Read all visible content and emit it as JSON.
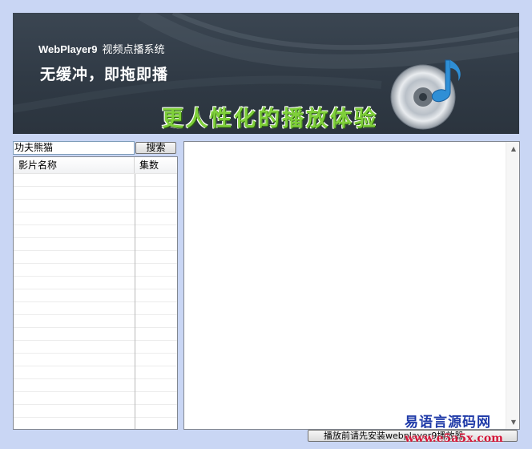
{
  "banner": {
    "app_name": "WebPlayer9",
    "subtitle": "视频点播系统",
    "slogan": "无缓冲，即拖即播",
    "tagline": "更人性化的播放体验",
    "logo_icon": "disc-music-icon"
  },
  "search": {
    "value": "功夫熊猫",
    "button_label": "搜索"
  },
  "list": {
    "columns": [
      "影片名称",
      "集数"
    ],
    "rows": []
  },
  "footer": {
    "install_label": "播放前请先安装webplayer9播放器"
  },
  "watermark": {
    "line1": "易语言源码网",
    "line2": "www.e5a5x.com"
  },
  "colors": {
    "window_bg": "#c9d6f4",
    "banner_bg": "#333d48",
    "tagline_green": "#7fcf3a"
  }
}
